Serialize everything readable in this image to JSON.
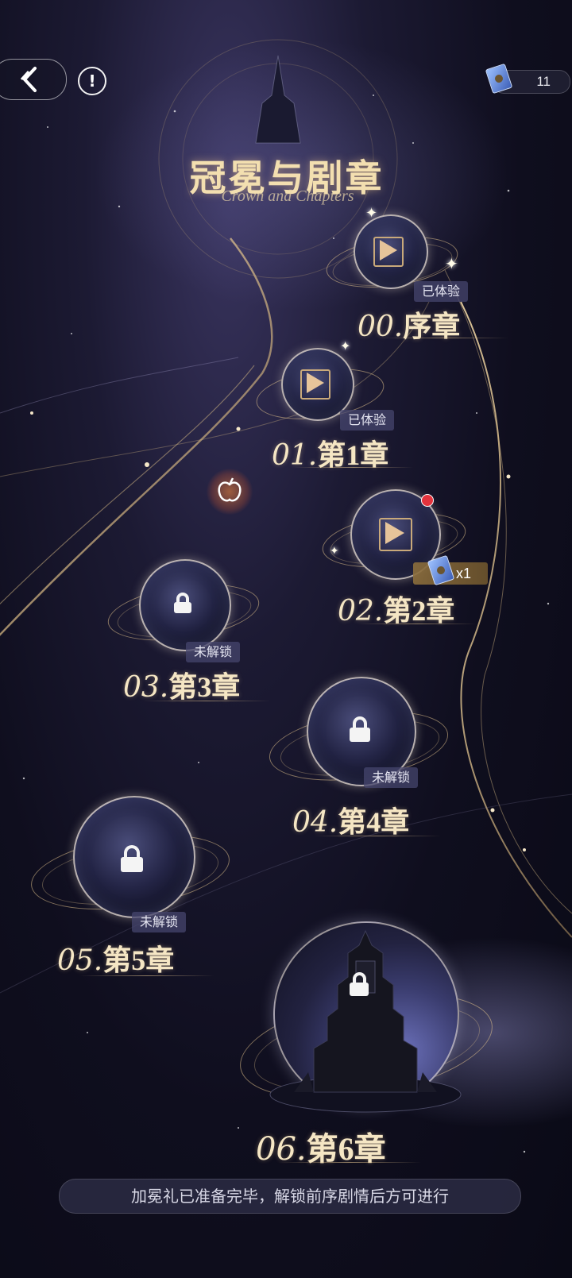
{
  "header": {
    "title": "冠冕与剧章",
    "subtitle": "Crown and Chapters",
    "currency_value": "11"
  },
  "icons": {
    "back": "chevron-left-icon",
    "info": "info-icon",
    "currency": "ticket-icon",
    "play": "play-icon",
    "lock": "lock-icon",
    "event": "apple-icon"
  },
  "chapters": [
    {
      "number": "00.",
      "name": "序章",
      "status": "已体验",
      "state": "played"
    },
    {
      "number": "01.",
      "name": "第1章",
      "status": "已体验",
      "state": "played"
    },
    {
      "number": "02.",
      "name": "第2章",
      "status": "",
      "state": "playable",
      "reward": "x1",
      "has_red_dot": true
    },
    {
      "number": "03.",
      "name": "第3章",
      "status": "未解锁",
      "state": "locked"
    },
    {
      "number": "04.",
      "name": "第4章",
      "status": "未解锁",
      "state": "locked"
    },
    {
      "number": "05.",
      "name": "第5章",
      "status": "未解锁",
      "state": "locked"
    },
    {
      "number": "06.",
      "name": "第6章",
      "status": "",
      "state": "locked"
    }
  ],
  "notice": "加冕礼已准备完毕，解锁前序剧情后方可进行",
  "colors": {
    "gold": "#e6c49a",
    "background": "#14132a",
    "badge_red": "#e3333d",
    "tag_bg": "#46466e"
  }
}
